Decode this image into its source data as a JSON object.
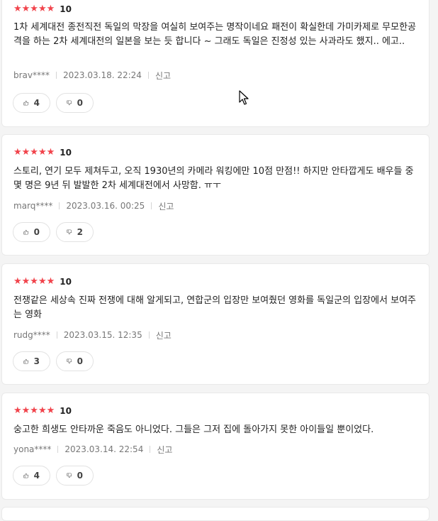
{
  "reviews": [
    {
      "stars": "★★★★★",
      "score": "10",
      "text": "1차 세계대전 종전직전 독일의 막장을 여실히 보여주는 명작이네요 패전이 확실한데 가미카제로 무모한공격을 하는 2차 세계대전의 일본을 보는 듯 합니다 ~ 그래도 독일은 진정성 있는 사과라도 했지.. 에고..",
      "user": "brav****",
      "date": "2023.03.18. 22:24",
      "report": "신고",
      "likes": "4",
      "dislikes": "0"
    },
    {
      "stars": "★★★★★",
      "score": "10",
      "text": "스토리, 연기 모두 제쳐두고, 오직 1930년의 카메라 워킹에만 10점 만점!! 하지만 안타깝게도 배우들 중 몇 명은 9년 뒤 발발한 2차 세계대전에서 사망함. ㅠㅜ",
      "user": "marq****",
      "date": "2023.03.16. 00:25",
      "report": "신고",
      "likes": "0",
      "dislikes": "2"
    },
    {
      "stars": "★★★★★",
      "score": "10",
      "text": "전쟁같은 세상속 진짜 전쟁에 대해 알게되고, 연합군의 입장만 보여줬던 영화를 독일군의 입장에서 보여주는 영화",
      "user": "rudg****",
      "date": "2023.03.15. 12:35",
      "report": "신고",
      "likes": "3",
      "dislikes": "0"
    },
    {
      "stars": "★★★★★",
      "score": "10",
      "text": "숭고한 희생도 안타까운 죽음도 아니었다. 그들은 그저 집에 돌아가지 못한 아이들일 뿐이었다.",
      "user": "yona****",
      "date": "2023.03.14. 22:54",
      "report": "신고",
      "likes": "4",
      "dislikes": "0"
    }
  ],
  "colors": {
    "star": "#f1434b",
    "meta": "#777777",
    "border": "#e2e2e2"
  },
  "icons": {
    "like": "thumbs-up-icon",
    "dislike": "thumbs-down-icon",
    "cursor": "mouse-pointer-icon"
  }
}
